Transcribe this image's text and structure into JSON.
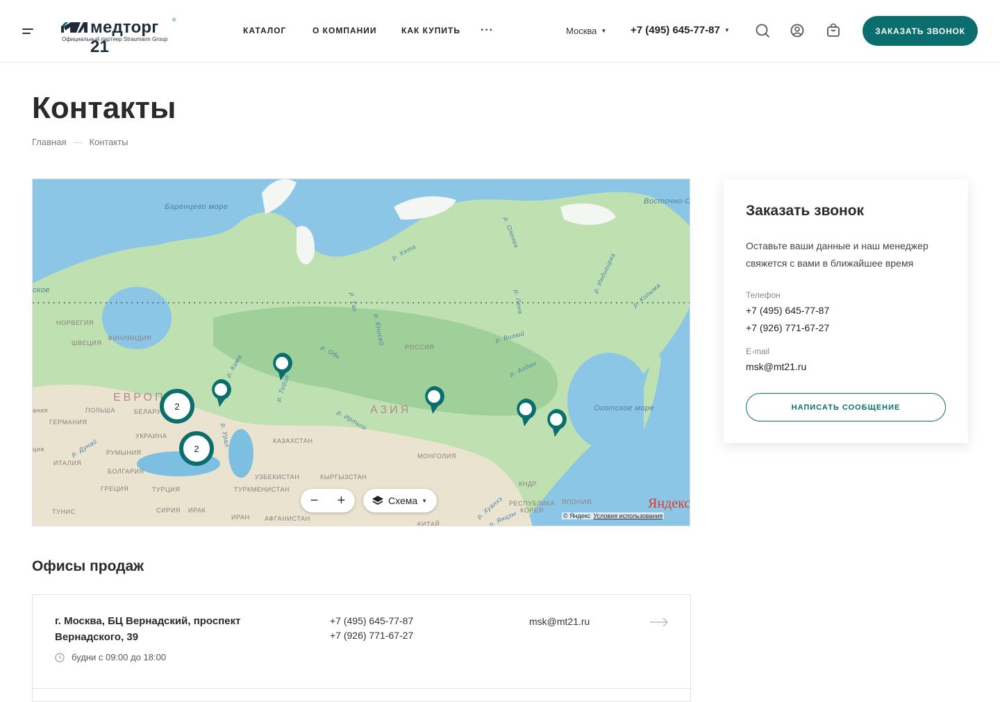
{
  "header": {
    "logo_text": "медторг 21",
    "logo_reg": "®",
    "logo_sub": "Официальный партнер Straumann Group",
    "nav": [
      "КАТАЛОГ",
      "О КОМПАНИИ",
      "КАК КУПИТЬ"
    ],
    "nav_more": "···",
    "city": "Москва",
    "phone": "+7 (495) 645-77-87",
    "call_button": "ЗАКАЗАТЬ ЗВОНОК",
    "accent_color": "#0b6e6e"
  },
  "page": {
    "title": "Контакты",
    "breadcrumb": [
      "Главная",
      "Контакты"
    ],
    "breadcrumb_sep": "—"
  },
  "map": {
    "labels": {
      "barents": "Баренцево море",
      "east_sib": "Восточно-Сибирское море",
      "okhotsk": "Охотское море",
      "europe": "ЕВРОП",
      "asia": "АЗИЯ",
      "russia": "РОССИЯ",
      "kazakhstan": "КАЗАХСТАН",
      "mongolia": "МОНГОЛИЯ",
      "norway": "НОРВЕГИЯ",
      "finland": "ФИНЛЯНДИЯ",
      "sweden": "ШВЕЦИЯ",
      "poland": "ПОЛЬША",
      "belarus": "БЕЛАРУ",
      "germany": "ГЕРМАНИЯ",
      "ukraine": "УКРАИНА",
      "romania": "РУМЫНИЯ",
      "italy": "ИТАЛИЯ",
      "bulgaria": "БОЛГАРИЯ",
      "greece": "ГРЕЦИЯ",
      "turkey": "ТУРЦИЯ",
      "syria": "СИРИЯ",
      "iraq": "ИРАК",
      "iran": "ИРАН",
      "tunisia": "ТУНИС",
      "afghanistan": "АФГАНИСТАН",
      "uzbekistan": "УЗБЕКИСТАН",
      "kyrgyzstan": "КЫРГЫЗСТАН",
      "turkmenistan": "ТУРКМЕНИСТАН",
      "china": "КИТАЙ",
      "dprk": "КНДР",
      "korea": "РЕСПУБЛИКА КОРЕЯ",
      "japan": "ЯПОНИЯ",
      "sea_left": "ское",
      "left1": "ания",
      "left2": "ция",
      "r_khatanga": "р. Хета",
      "r_olenek": "р. Оленек",
      "r_indigirka": "р. Индигирка",
      "r_kolyma": "р. Колыма",
      "r_lena": "р. Лена",
      "r_vilyuy": "р. Вилюй",
      "r_aldan": "р. Алдан",
      "r_yenisei": "р. Енисей",
      "r_ob": "р. Обь",
      "r_kama": "р. Кама",
      "r_tobol": "р. Тобол",
      "r_irtysh": "р. Иртыш",
      "r_ural": "р. Урал",
      "r_don": "р. Дунай",
      "r_taz": "р. Таз",
      "r_khuanhe": "р. Хуанхэ",
      "r_yanzy": "р. Янцзы"
    },
    "clusters": [
      "2",
      "2"
    ],
    "zoom_out": "−",
    "zoom_in": "+",
    "layer_label": "Схема",
    "yandex_logo": "Яндекс",
    "copyright": "© Яндекс",
    "terms_link": "Условия использования"
  },
  "callback": {
    "title": "Заказать звонок",
    "description": "Оставьте ваши данные и наш менеджер свяжется с вами в ближайшее время",
    "phone_label": "Телефон",
    "phones": [
      "+7 (495) 645-77-87",
      "+7 (926) 771-67-27"
    ],
    "email_label": "E-mail",
    "email": "msk@mt21.ru",
    "button": "НАПИСАТЬ СООБЩЕНИЕ"
  },
  "offices": {
    "title": "Офисы продаж",
    "items": [
      {
        "address": "г. Москва, БЦ Вернадский, проспект Вернадского, 39",
        "hours": "будни с 09:00 до 18:00",
        "phones": [
          "+7 (495) 645-77-87",
          "+7 (926) 771-67-27"
        ],
        "email": "msk@mt21.ru"
      }
    ]
  }
}
